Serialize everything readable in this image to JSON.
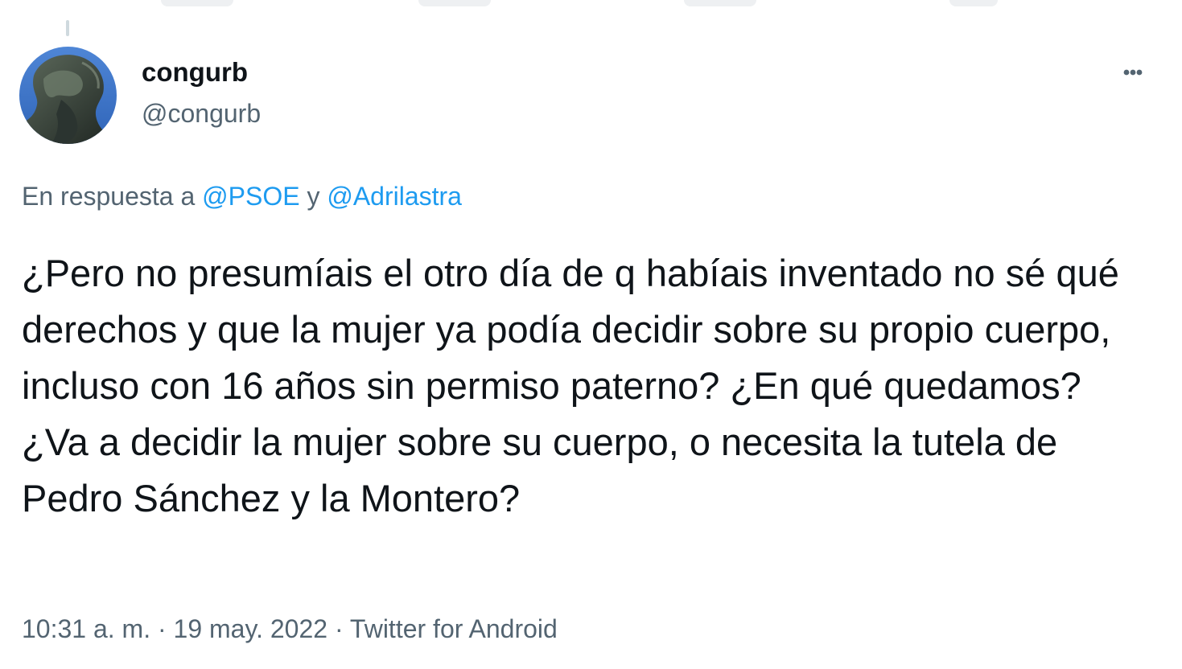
{
  "colors": {
    "text_primary": "#0f1419",
    "text_secondary": "#536471",
    "link": "#1d9bf0",
    "background": "#ffffff"
  },
  "author": {
    "display_name": "congurb",
    "handle": "@congurb",
    "avatar_icon": "statue-avatar"
  },
  "menu": {
    "more_icon": "more-horizontal-icon"
  },
  "reply_context": {
    "prefix": "En respuesta a ",
    "mentions": [
      "@PSOE",
      "@Adrilastra"
    ],
    "conjunction": " y "
  },
  "tweet": {
    "text": "¿Pero no presumíais el otro día de q habíais inventado no sé qué derechos y que la mujer ya podía decidir sobre su propio cuerpo, incluso con 16 años sin permiso paterno? ¿En qué quedamos? ¿Va a decidir la mujer sobre su cuerpo, o necesita la tutela de Pedro Sánchez y la Montero?"
  },
  "meta": {
    "time": "10:31 a. m.",
    "separator": " · ",
    "date": "19 may. 2022",
    "source": "Twitter for Android"
  }
}
